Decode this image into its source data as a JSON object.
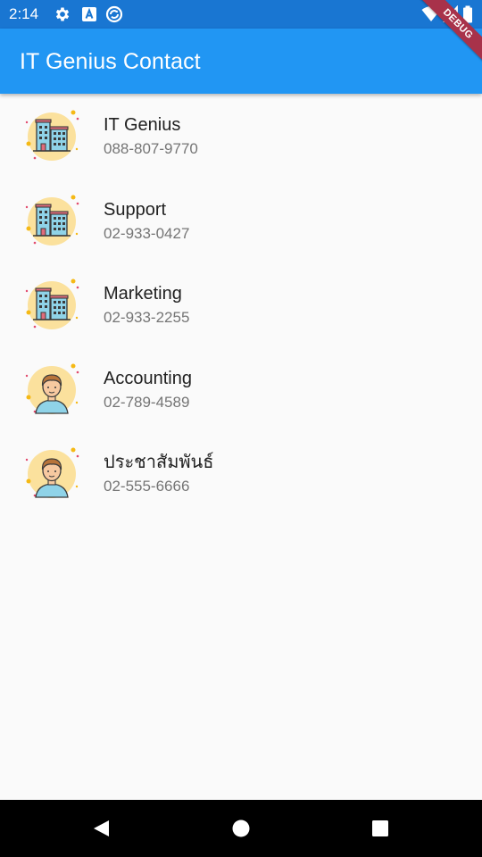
{
  "status_bar": {
    "time": "2:14",
    "icons": [
      "gear-icon",
      "font-a-icon",
      "sync-icon",
      "wifi-icon",
      "signal-icon",
      "battery-icon"
    ]
  },
  "app_bar": {
    "title": "IT Genius Contact",
    "color": "#2196f3"
  },
  "debug_banner": {
    "label": "DEBUG"
  },
  "contacts": [
    {
      "name": "IT Genius",
      "phone": "088-807-9770",
      "avatar": "building-avatar-icon"
    },
    {
      "name": "Support",
      "phone": "02-933-0427",
      "avatar": "building-avatar-icon"
    },
    {
      "name": "Marketing",
      "phone": "02-933-2255",
      "avatar": "building-avatar-icon"
    },
    {
      "name": "Accounting",
      "phone": "02-789-4589",
      "avatar": "person-avatar-icon"
    },
    {
      "name": "ประชาสัมพันธ์",
      "phone": "02-555-6666",
      "avatar": "person-avatar-icon"
    }
  ],
  "nav_bar": {
    "buttons": [
      "back-icon",
      "home-icon",
      "recents-icon"
    ]
  }
}
